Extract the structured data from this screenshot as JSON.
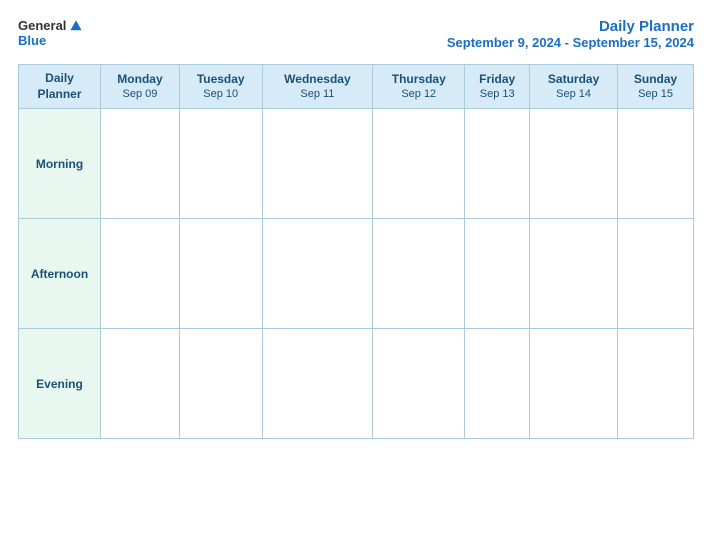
{
  "logo": {
    "general": "General",
    "blue": "Blue"
  },
  "header": {
    "title": "Daily Planner",
    "date_range": "September 9, 2024 - September 15, 2024"
  },
  "columns": [
    {
      "day": "Daily\nPlanner",
      "date": ""
    },
    {
      "day": "Monday",
      "date": "Sep 09"
    },
    {
      "day": "Tuesday",
      "date": "Sep 10"
    },
    {
      "day": "Wednesday",
      "date": "Sep 11"
    },
    {
      "day": "Thursday",
      "date": "Sep 12"
    },
    {
      "day": "Friday",
      "date": "Sep 13"
    },
    {
      "day": "Saturday",
      "date": "Sep 14"
    },
    {
      "day": "Sunday",
      "date": "Sep 15"
    }
  ],
  "rows": [
    {
      "label": "Morning"
    },
    {
      "label": "Afternoon"
    },
    {
      "label": "Evening"
    }
  ]
}
